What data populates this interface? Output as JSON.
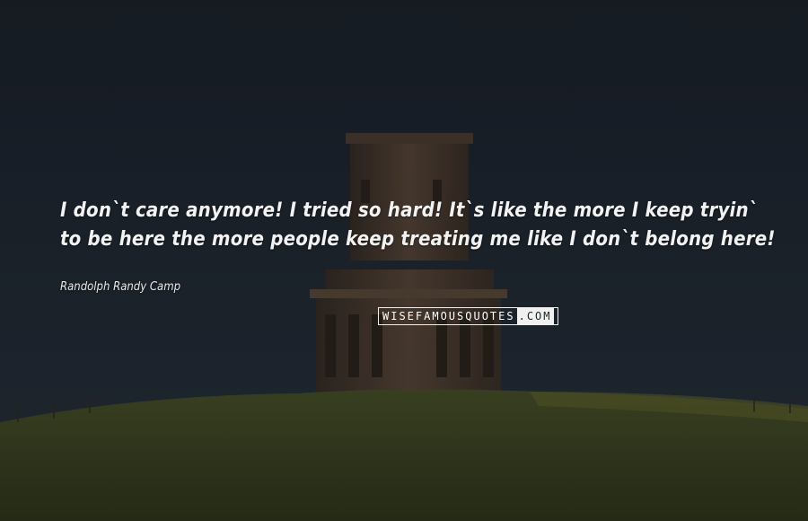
{
  "quote": {
    "text": "I don`t care anymore! I tried so hard! It`s like the more I keep tryin` to be here the more people keep treating me like I don`t belong here!",
    "author": "Randolph Randy Camp"
  },
  "watermark": {
    "left": "WISEFAMOUSQUOTES",
    "right": ".COM"
  },
  "colors": {
    "sky": "#1c232d",
    "hill": "#3a4223",
    "tower": "#4a3a2e",
    "text": "#f2f2f2"
  }
}
